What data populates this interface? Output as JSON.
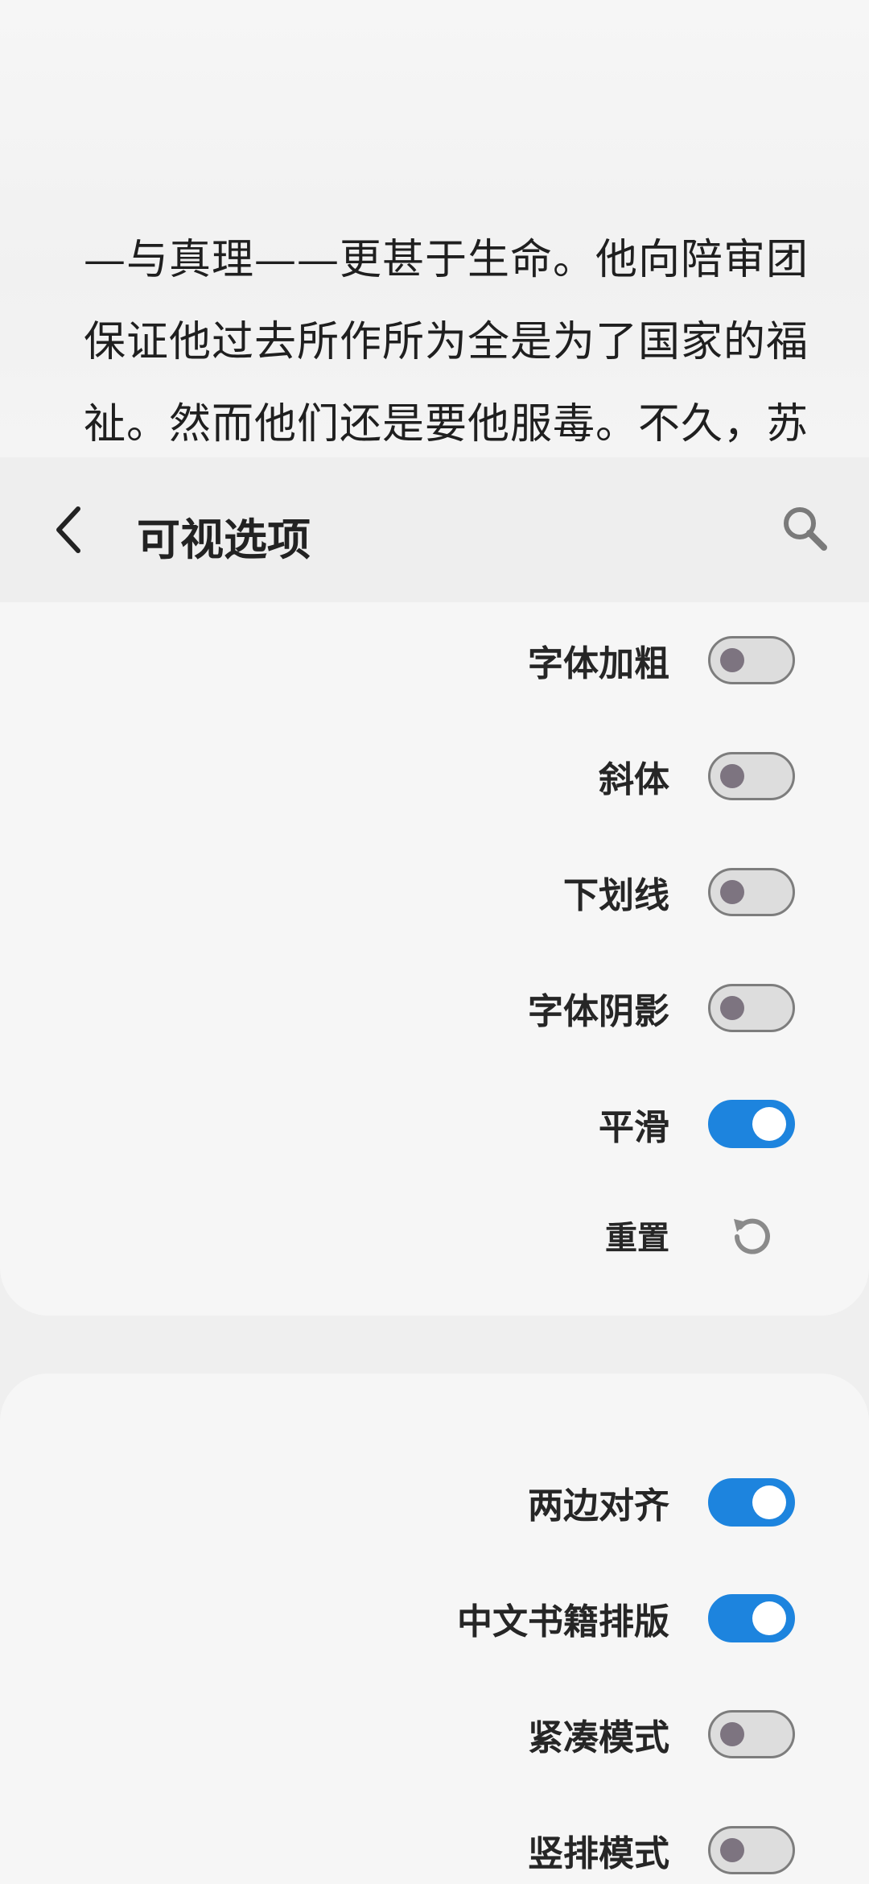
{
  "reader": {
    "line1": "—与真理——更甚于生命。他向陪审团",
    "line2": "保证他过去所作所为全是为了国家的福",
    "line3": "祉。然而他们还是要他服毒。不久，苏"
  },
  "appbar": {
    "title": "可视选项",
    "back_icon": "chevron-left-icon",
    "search_icon": "search-icon"
  },
  "card1": {
    "items": [
      {
        "label": "字体加粗",
        "checked": false
      },
      {
        "label": "斜体",
        "checked": false
      },
      {
        "label": "下划线",
        "checked": false
      },
      {
        "label": "字体阴影",
        "checked": false
      },
      {
        "label": "平滑",
        "checked": true
      }
    ],
    "reset_label": "重置",
    "reset_icon": "reset-icon"
  },
  "card2": {
    "items": [
      {
        "label": "两边对齐",
        "checked": true
      },
      {
        "label": "中文书籍排版",
        "checked": true
      },
      {
        "label": "紧凑模式",
        "checked": false
      },
      {
        "label": "竖排模式",
        "checked": false
      }
    ]
  },
  "colors": {
    "accent": "#1d84de",
    "toggle_off_track": "#dddddd",
    "toggle_off_border": "#7d7d7d",
    "card_bg": "#f6f6f6",
    "page_bg": "#efefef"
  }
}
